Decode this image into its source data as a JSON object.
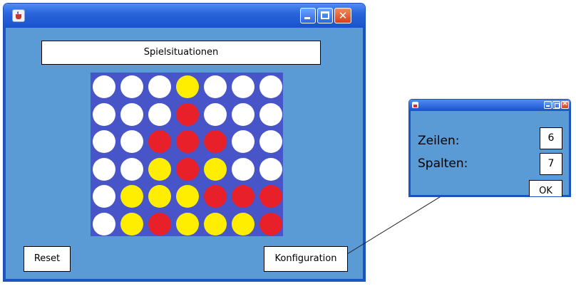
{
  "main_window": {
    "heading": "Spielsituationen",
    "reset_label": "Reset",
    "konfiguration_label": "Konfiguration"
  },
  "board": {
    "rows": 6,
    "cols": 7,
    "colors": {
      "board": "#4855c8",
      "empty": "#ffffff",
      "red": "#e8202a",
      "yellow": "#ffee00"
    },
    "cells": [
      [
        "empty",
        "empty",
        "empty",
        "yellow",
        "empty",
        "empty",
        "empty"
      ],
      [
        "empty",
        "empty",
        "empty",
        "red",
        "empty",
        "empty",
        "empty"
      ],
      [
        "empty",
        "empty",
        "red",
        "red",
        "red",
        "empty",
        "empty"
      ],
      [
        "empty",
        "empty",
        "yellow",
        "red",
        "yellow",
        "empty",
        "empty"
      ],
      [
        "empty",
        "yellow",
        "yellow",
        "yellow",
        "red",
        "red",
        "red"
      ],
      [
        "empty",
        "yellow",
        "red",
        "yellow",
        "yellow",
        "yellow",
        "red"
      ]
    ]
  },
  "config_dialog": {
    "zeilen_label": "Zeilen:",
    "zeilen_value": "6",
    "spalten_label": "Spalten:",
    "spalten_value": "7",
    "ok_label": "OK"
  },
  "theme": {
    "window_client": "#5b9bd5",
    "titlebar": "#2a65dc"
  }
}
